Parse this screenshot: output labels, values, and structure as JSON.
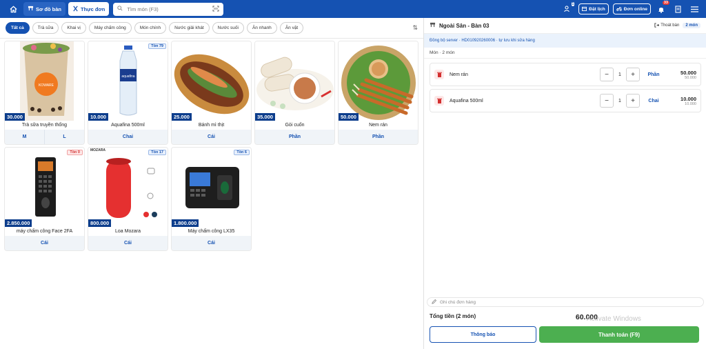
{
  "topbar": {
    "home_icon": "home-icon",
    "nav_tables": "Sơ đồ bàn",
    "nav_menu": "Thực đơn",
    "search_placeholder": "Tìm món (F3)",
    "booking": "Đặt lịch",
    "online_orders": "Đơn online",
    "notification_count": "33",
    "user_badge": "1",
    "colors": {
      "bar": "#1552b2",
      "accent_green": "#4caf50"
    }
  },
  "categories": [
    "Tất cả",
    "Trà sữa",
    "Khai vị",
    "Máy chấm công",
    "Món chính",
    "Nước giải khát",
    "Nước suối",
    "Ăn nhanh",
    "Ăn vặt"
  ],
  "products": [
    {
      "name": "Trà sữa truyền thống",
      "price": "30.000",
      "stock": "",
      "units": [
        "M",
        "L"
      ],
      "img": "milktea"
    },
    {
      "name": "Aquafina 500ml",
      "price": "10.000",
      "stock": "Tồn 79",
      "units": [
        "Chai"
      ],
      "img": "bottle"
    },
    {
      "name": "Bánh mì thịt",
      "price": "25.000",
      "stock": "",
      "units": [
        "Cái"
      ],
      "img": "banhmi"
    },
    {
      "name": "Gỏi cuốn",
      "price": "35.000",
      "stock": "",
      "units": [
        "Phần"
      ],
      "img": "roll"
    },
    {
      "name": "Nem rán",
      "price": "50.000",
      "stock": "",
      "units": [
        "Phần"
      ],
      "img": "nem"
    },
    {
      "name": "máy chấm công Face 2FA",
      "price": "2.850.000",
      "stock": "Tồn 0",
      "units": [
        "Cái"
      ],
      "img": "face"
    },
    {
      "name": "Loa Mozara",
      "price": "800.000",
      "stock": "Tồn 17",
      "units": [
        "Cái"
      ],
      "img": "speaker",
      "brand": "MOZARA"
    },
    {
      "name": "Máy chấm công LX35",
      "price": "1.800.000",
      "stock": "Tồn 6",
      "units": [
        "Cái"
      ],
      "img": "lx35"
    }
  ],
  "panel": {
    "table_name": "Ngoài Sân - Bàn 03",
    "exit_table": "Thoát bàn",
    "item_count": "2 món",
    "sync_text": "Đồng bộ server · HD010920260006 · tự lưu khi sửa hàng",
    "items_header": "Món · 2 món",
    "lines": [
      {
        "name": "Nem rán",
        "qty": "1",
        "unit": "Phần",
        "total": "50.000",
        "unit_price": "50.000"
      },
      {
        "name": "Aquafina 500ml",
        "qty": "1",
        "unit": "Chai",
        "total": "10.000",
        "unit_price": "10.000"
      }
    ],
    "note_placeholder": "Ghi chú đơn hàng",
    "total_label": "Tổng tiền (2 món)",
    "total_value": "60.000",
    "notify_button": "Thông báo",
    "pay_button": "Thanh toán (F9)",
    "watermark": "Activate Windows"
  }
}
